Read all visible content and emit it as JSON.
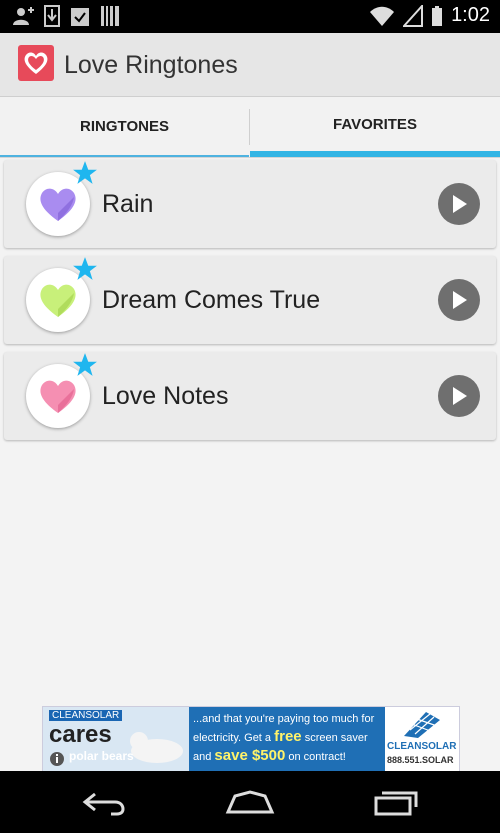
{
  "status_bar": {
    "time": "1:02"
  },
  "app_bar": {
    "title": "Love Ringtones"
  },
  "tabs": [
    {
      "label": "RINGTONES"
    },
    {
      "label": "FAVORITES"
    }
  ],
  "ringtones": [
    {
      "title": "Rain",
      "heart_color": "#a98cf0"
    },
    {
      "title": "Dream Comes True",
      "heart_color": "#c8f07a"
    },
    {
      "title": "Love Notes",
      "heart_color": "#f58fb2"
    }
  ],
  "ad": {
    "brand": "CLEANSOLAR",
    "headline": "cares",
    "subline": "polar bears",
    "text1": "...and that you're paying too much for electricity. Get a",
    "free": "free",
    "text2": "screen saver and",
    "save": "save $500",
    "text3": "on contract!",
    "logo_text": "CLEANSOLAR",
    "phone": "888.551.SOLAR"
  },
  "colors": {
    "accent": "#33b5e5",
    "star": "#1fb6ef"
  }
}
